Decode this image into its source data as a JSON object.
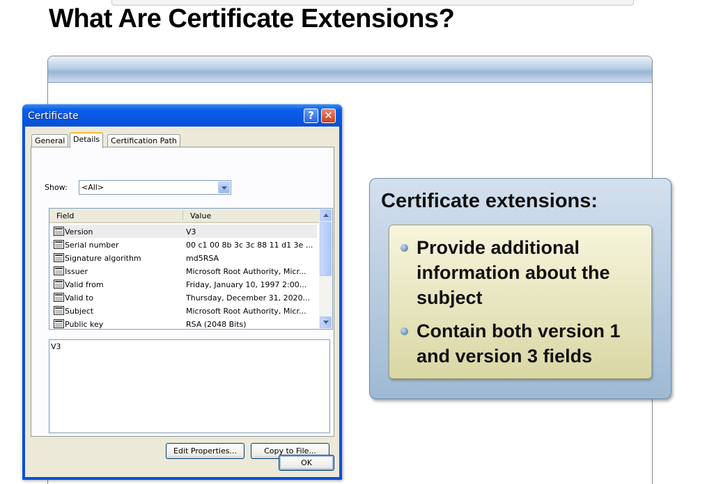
{
  "slide": {
    "title": "What Are Certificate Extensions?"
  },
  "callout": {
    "title": "Certificate extensions:",
    "bullets": [
      "Provide additional information about the subject",
      "Contain both version 1 and version 3 fields"
    ]
  },
  "dialog": {
    "title": "Certificate",
    "help_label": "?",
    "close_label": "✕",
    "tabs": [
      {
        "label": "General"
      },
      {
        "label": "Details",
        "active": true
      },
      {
        "label": "Certification Path"
      }
    ],
    "show_label": "Show:",
    "show_value": "<All>",
    "columns": [
      "Field",
      "Value"
    ],
    "rows": [
      {
        "field": "Version",
        "value": "V3",
        "selected": true
      },
      {
        "field": "Serial number",
        "value": "00 c1 00 8b 3c 3c 88 11 d1 3e ..."
      },
      {
        "field": "Signature algorithm",
        "value": "md5RSA"
      },
      {
        "field": "Issuer",
        "value": "Microsoft Root Authority, Micr..."
      },
      {
        "field": "Valid from",
        "value": "Friday, January 10, 1997 2:00..."
      },
      {
        "field": "Valid to",
        "value": "Thursday, December 31, 2020..."
      },
      {
        "field": "Subject",
        "value": "Microsoft Root Authority, Micr..."
      },
      {
        "field": "Public key",
        "value": "RSA (2048 Bits)"
      }
    ],
    "detail_value": "V3",
    "buttons": {
      "edit_properties": "Edit Properties...",
      "copy_to_file": "Copy to File...",
      "ok": "OK"
    }
  },
  "colors": {
    "titlebar": "#0a5fe8",
    "dialog_face": "#ece9d8",
    "callout_outer": "#b4c9df",
    "callout_inner": "#ebe9c2"
  }
}
